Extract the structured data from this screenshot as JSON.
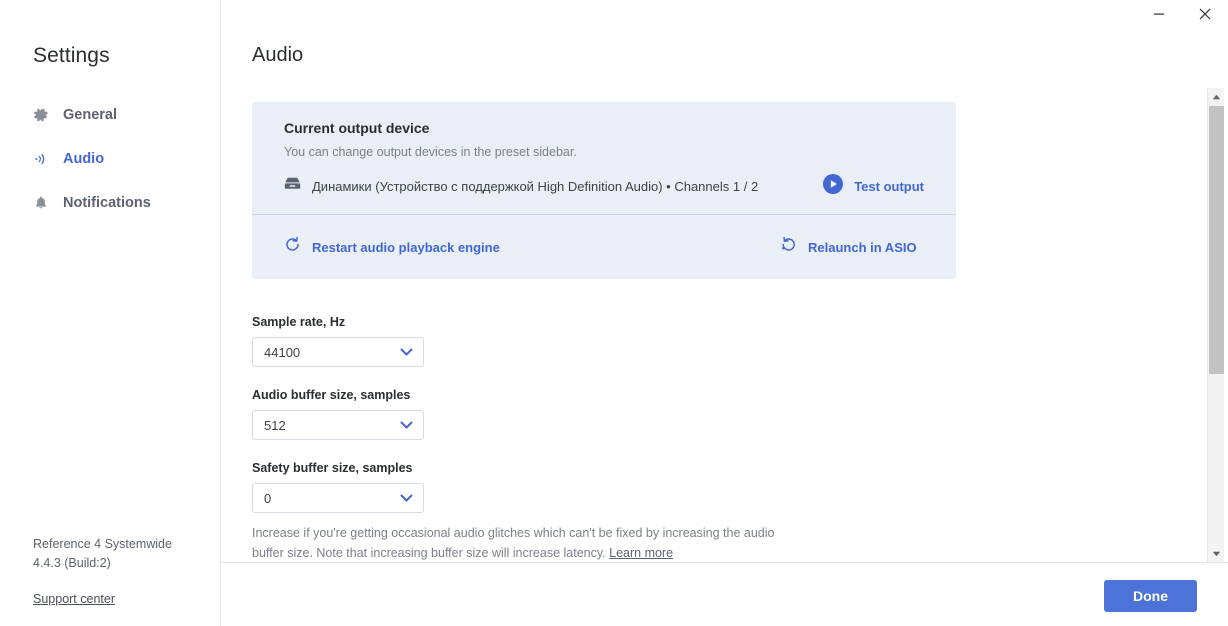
{
  "window": {
    "minimize_label": "Minimize",
    "close_label": "Close"
  },
  "sidebar": {
    "title": "Settings",
    "items": [
      {
        "label": "General",
        "icon": "gear-icon",
        "active": false
      },
      {
        "label": "Audio",
        "icon": "audio-waves-icon",
        "active": true
      },
      {
        "label": "Notifications",
        "icon": "bell-icon",
        "active": false
      }
    ],
    "version_line1": "Reference 4 Systemwide",
    "version_line2": "4.4.3 (Build:2)",
    "support_link": "Support center"
  },
  "main": {
    "page_title": "Audio",
    "card": {
      "heading": "Current output device",
      "subtitle": "You can change output devices in the preset sidebar.",
      "device_name": "Динамики (Устройство с поддержкой High Definition Audio) • Channels 1 / 2",
      "device_icon": "speaker-device-icon",
      "test_output_label": "Test output",
      "test_output_icon": "play-circle-icon",
      "restart_label": "Restart audio playback engine",
      "restart_icon": "refresh-icon",
      "relaunch_label": "Relaunch in ASIO",
      "relaunch_icon": "restore-icon"
    },
    "fields": [
      {
        "label": "Sample rate, Hz",
        "value": "44100"
      },
      {
        "label": "Audio buffer size, samples",
        "value": "512"
      },
      {
        "label": "Safety buffer size, samples",
        "value": "0"
      }
    ],
    "helper_text": "Increase if you're getting occasional audio glitches which can't be fixed by increasing the audio buffer size. Note that increasing buffer size will increase latency. ",
    "helper_link": "Learn more"
  },
  "footer": {
    "done_label": "Done"
  },
  "colors": {
    "accent_blue": "#4267d4",
    "button_blue": "#4c73d8",
    "card_bg": "#e9eef7",
    "text_primary": "#2a2d34",
    "text_muted": "#7b808b"
  }
}
